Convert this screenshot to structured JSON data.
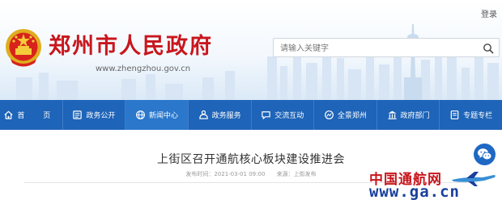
{
  "header": {
    "login_label": "登录",
    "site_title": "郑州市人民政府",
    "site_url": "www.zhengzhou.gov.cn",
    "brand_color": "#c8161d",
    "emblem_icon": "national-emblem-icon"
  },
  "search": {
    "placeholder": "请输入关键字",
    "value": "",
    "icon": "search-icon"
  },
  "nav": {
    "background": "#1e64b8",
    "items": [
      {
        "label": "首  页",
        "icon": "home-icon"
      },
      {
        "label": "政务公开",
        "icon": "open-affairs-icon"
      },
      {
        "label": "新闻中心",
        "icon": "globe-icon",
        "active": true
      },
      {
        "label": "政务服务",
        "icon": "service-icon"
      },
      {
        "label": "交流互动",
        "icon": "chat-icon"
      },
      {
        "label": "全景郑州",
        "icon": "panorama-icon"
      },
      {
        "label": "政府部门",
        "icon": "government-building-icon"
      },
      {
        "label": "专题专栏",
        "icon": "topic-icon"
      }
    ]
  },
  "article": {
    "title": "上街区召开通航核心板块建设推进会",
    "publish_time_label": "发布时间：2021-03-01 09:00",
    "source_label": "来源：上街发布"
  },
  "float": {
    "wechat_icon": "wechat-icon"
  },
  "watermark": {
    "text_cn": "中国通航网",
    "url": "www.ga.cn",
    "icon": "airplane-icon"
  }
}
